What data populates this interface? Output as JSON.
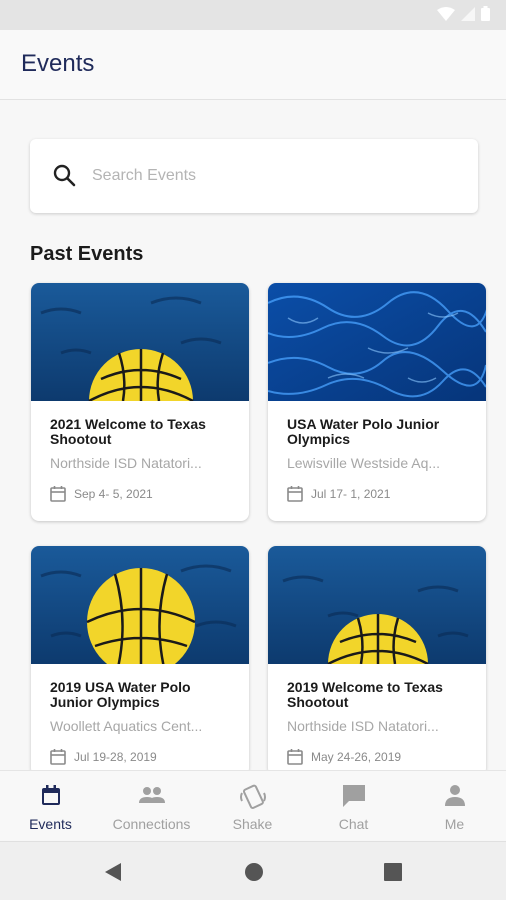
{
  "app_bar": {
    "title": "Events"
  },
  "search": {
    "placeholder": "Search Events"
  },
  "section": {
    "title": "Past Events"
  },
  "events": [
    {
      "title": "2021 Welcome to Texas Shootout",
      "venue": "Northside ISD Natatori...",
      "date": "Sep  4- 5, 2021",
      "image": "water-polo-ball"
    },
    {
      "title": "USA Water Polo Junior Olympics",
      "venue": "Lewisville Westside Aq...",
      "date": "Jul 17- 1, 2021",
      "image": "pool-water"
    },
    {
      "title": "2019 USA Water Polo Junior Olympics",
      "venue": "Woollett Aquatics Cent...",
      "date": "Jul 19-28, 2019",
      "image": "water-polo-ball"
    },
    {
      "title": "2019 Welcome to Texas Shootout",
      "venue": "Northside ISD Natatori...",
      "date": "May 24-26, 2019",
      "image": "water-polo-ball"
    }
  ],
  "bottom_nav": {
    "items": [
      {
        "label": "Events",
        "icon": "calendar-icon",
        "active": true
      },
      {
        "label": "Connections",
        "icon": "people-icon",
        "active": false
      },
      {
        "label": "Shake",
        "icon": "shake-phone-icon",
        "active": false
      },
      {
        "label": "Chat",
        "icon": "chat-bubble-icon",
        "active": false
      },
      {
        "label": "Me",
        "icon": "person-icon",
        "active": false
      }
    ]
  },
  "colors": {
    "accent": "#1f2a5a",
    "inactive": "#a0a0a0",
    "ball_yellow": "#f2d52a",
    "water_blue": "#12457d"
  }
}
